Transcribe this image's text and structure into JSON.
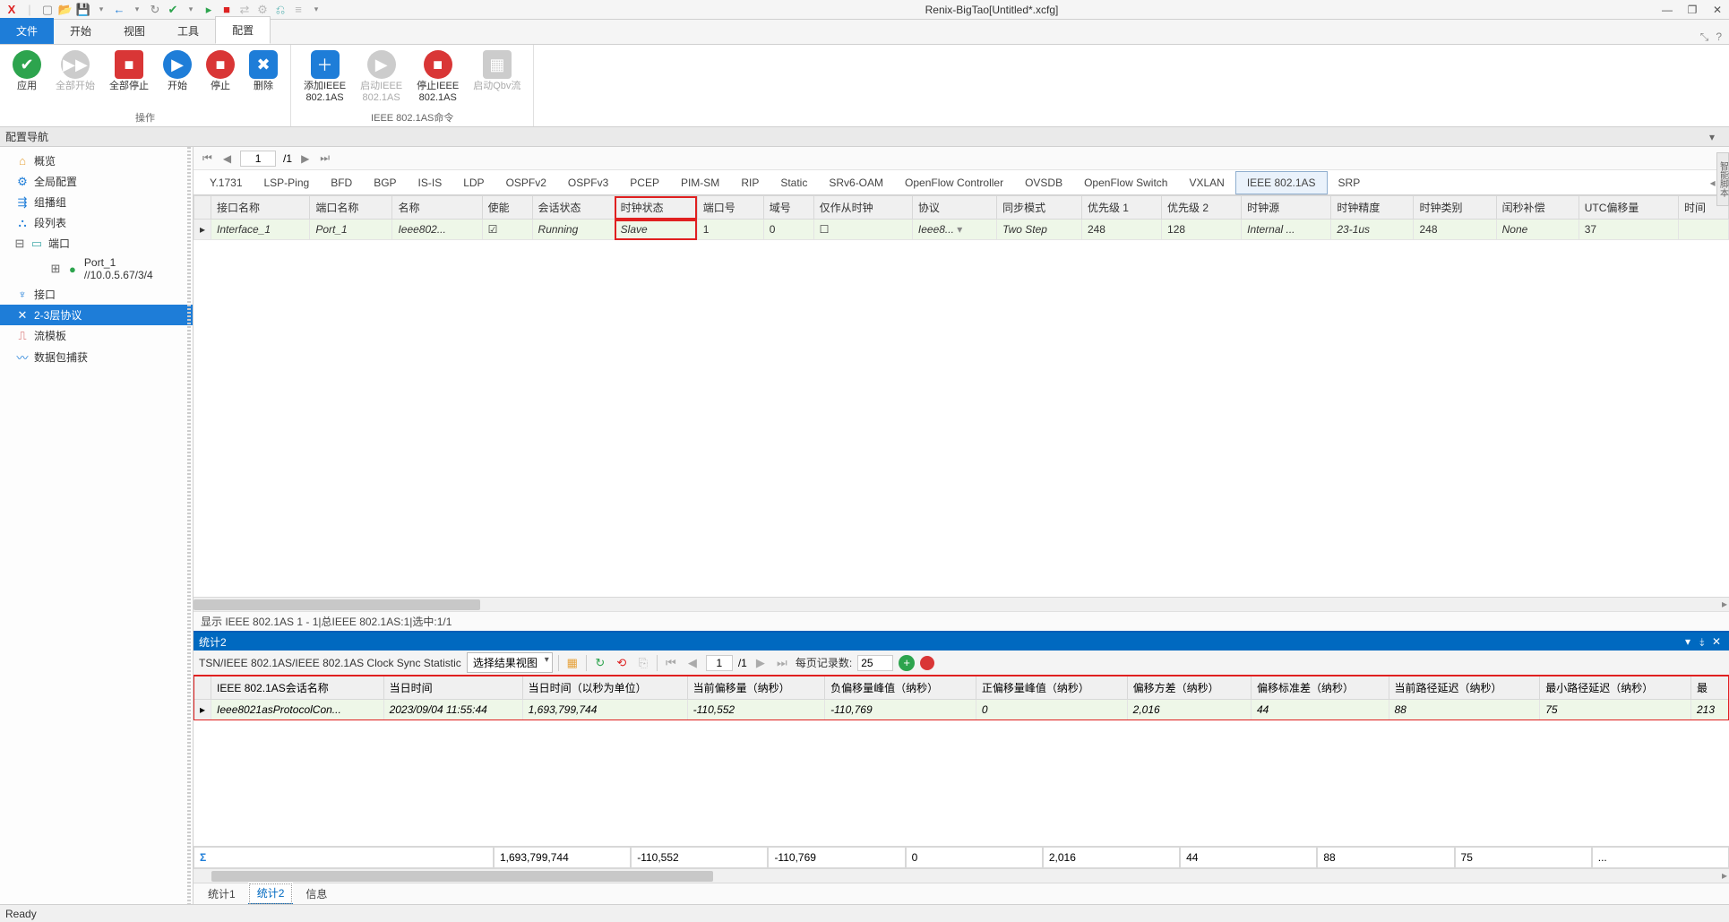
{
  "app_title": "Renix-BigTao[Untitled*.xcfg]",
  "menu_tabs": {
    "file": "文件",
    "start": "开始",
    "view": "视图",
    "tool": "工具",
    "config": "配置"
  },
  "ribbon": {
    "group1": {
      "label": "操作",
      "apply": "应用",
      "startAll": "全部开始",
      "stopAll": "全部停止",
      "start": "开始",
      "stop": "停止",
      "delete": "删除"
    },
    "group2": {
      "label": "IEEE 802.1AS命令",
      "addIeee": "添加IEEE\n802.1AS",
      "startIeee": "启动IEEE\n802.1AS",
      "stopIeee": "停止IEEE\n802.1AS",
      "startQbv": "启动Qbv流"
    }
  },
  "nav_header": "配置导航",
  "tree": {
    "overview": "概览",
    "global": "全局配置",
    "multicast": "组播组",
    "segment": "段列表",
    "port": "端口",
    "port1": "Port_1 //10.0.5.67/3/4",
    "iface": "接口",
    "l23": "2-3层协议",
    "template": "流模板",
    "capture": "数据包捕获"
  },
  "pager": {
    "page": "1",
    "total": "/1"
  },
  "proto_tabs": [
    "Y.1731",
    "LSP-Ping",
    "BFD",
    "BGP",
    "IS-IS",
    "LDP",
    "OSPFv2",
    "OSPFv3",
    "PCEP",
    "PIM-SM",
    "RIP",
    "Static",
    "SRv6-OAM",
    "OpenFlow Controller",
    "OVSDB",
    "OpenFlow Switch",
    "VXLAN",
    "IEEE 802.1AS",
    "SRP"
  ],
  "proto_active_index": 17,
  "grid_headers": [
    "接口名称",
    "端口名称",
    "名称",
    "使能",
    "会话状态",
    "时钟状态",
    "端口号",
    "域号",
    "仅作从时钟",
    "协议",
    "同步模式",
    "优先级 1",
    "优先级 2",
    "时钟源",
    "时钟精度",
    "时钟类别",
    "闰秒补偿",
    "UTC偏移量",
    "时间"
  ],
  "grid_row": {
    "iface": "Interface_1",
    "port": "Port_1",
    "name": "Ieee802...",
    "enabled": "☑",
    "session": "Running",
    "clock": "Slave",
    "portno": "1",
    "domain": "0",
    "slaveonly": "☐",
    "proto": "Ieee8...",
    "sync": "Two Step",
    "p1": "248",
    "p2": "128",
    "src": "Internal ...",
    "acc": "23-1us",
    "cls": "248",
    "leap": "None",
    "utc": "37",
    "time": ""
  },
  "grid_status": "显示 IEEE 802.1AS 1 - 1|总IEEE 802.1AS:1|选中:1/1",
  "stats": {
    "title": "统计2",
    "breadcrumb": "TSN/IEEE 802.1AS/IEEE 802.1AS Clock Sync Statistic",
    "view_dd": "选择结果视图",
    "page": "1",
    "page_total": "/1",
    "per_label": "每页记录数:",
    "per_val": "25",
    "headers": [
      "IEEE 802.1AS会话名称",
      "当日时间",
      "当日时间（以秒为单位）",
      "当前偏移量（纳秒）",
      "负偏移量峰值（纳秒）",
      "正偏移量峰值（纳秒）",
      "偏移方差（纳秒）",
      "偏移标准差（纳秒）",
      "当前路径延迟（纳秒）",
      "最小路径延迟（纳秒）",
      "最"
    ],
    "row": [
      "Ieee8021asProtocolCon...",
      "2023/09/04 11:55:44",
      "1,693,799,744",
      "-110,552",
      "-110,769",
      "0",
      "2,016",
      "44",
      "88",
      "75",
      "213"
    ],
    "summary": [
      "1,693,799,744",
      "-110,552",
      "-110,769",
      "0",
      "2,016",
      "44",
      "88",
      "75",
      "..."
    ]
  },
  "bottom_tabs": {
    "t1": "统计1",
    "t2": "统计2",
    "t3": "信息"
  },
  "status_text": "Ready",
  "side_label": "智能脚本"
}
